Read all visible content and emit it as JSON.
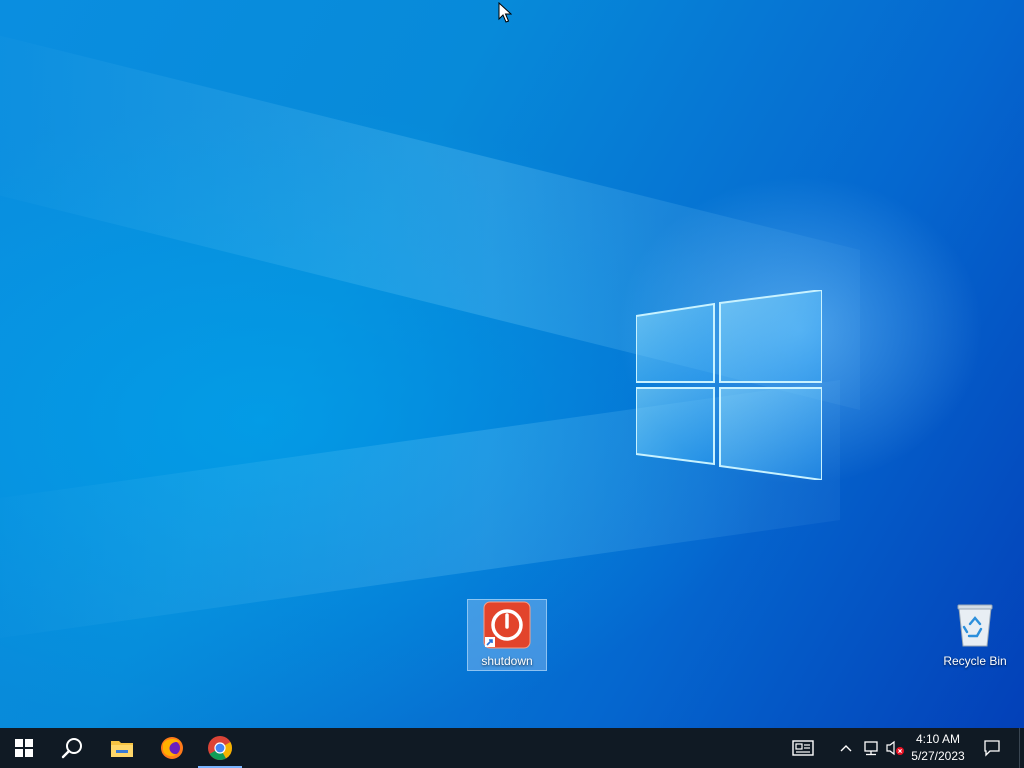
{
  "desktop": {
    "icons": [
      {
        "label": "shutdown",
        "icon": "power-icon",
        "selected": true
      },
      {
        "label": "Recycle Bin",
        "icon": "recycle-bin-icon",
        "selected": false
      }
    ]
  },
  "taskbar": {
    "start": {
      "icon": "windows-start-icon"
    },
    "search": {
      "icon": "search-icon"
    },
    "pinned": [
      {
        "name": "File Explorer",
        "icon": "folder-icon",
        "active": false
      },
      {
        "name": "Firefox",
        "icon": "firefox-icon",
        "active": false
      },
      {
        "name": "Chrome",
        "icon": "chrome-icon",
        "active": true
      }
    ],
    "tray": {
      "icons": [
        "news-icon",
        "chevron-up-icon",
        "network-icon",
        "volume-muted-icon"
      ],
      "time": "4:10 AM",
      "date": "5/27/2023",
      "notifications_icon": "notification-icon"
    }
  },
  "colors": {
    "taskbar": "#101a24",
    "desktop_accent": "#0a8ee0",
    "selection": "#b4d7ff"
  }
}
